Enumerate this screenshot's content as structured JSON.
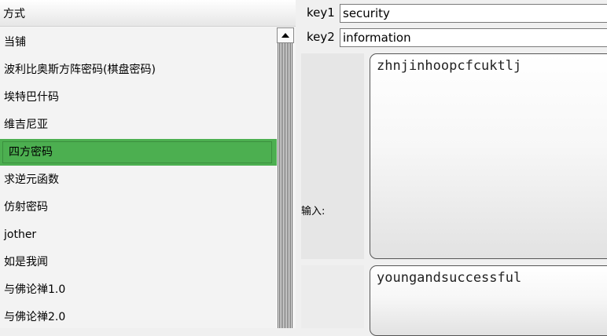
{
  "list": {
    "header": "方式",
    "items": [
      "当铺",
      "波利比奥斯方阵密码(棋盘密码)",
      "埃特巴什码",
      "维吉尼亚",
      "四方密码",
      "求逆元函数",
      "仿射密码",
      "jother",
      "如是我闻",
      "与佛论禅1.0",
      "与佛论禅2.0"
    ],
    "selected_index": 4
  },
  "keys": {
    "key1_label": "key1",
    "key1_value": "security",
    "key2_label": "key2",
    "key2_value": "information"
  },
  "io": {
    "input_label": "输入:",
    "input_text": "zhnjinhoopcfcuktlj",
    "output_text": "youngandsuccessful"
  },
  "colors": {
    "selected_bg": "#4caf50"
  },
  "icons": {
    "scroll_up": "triangle-up-icon"
  }
}
